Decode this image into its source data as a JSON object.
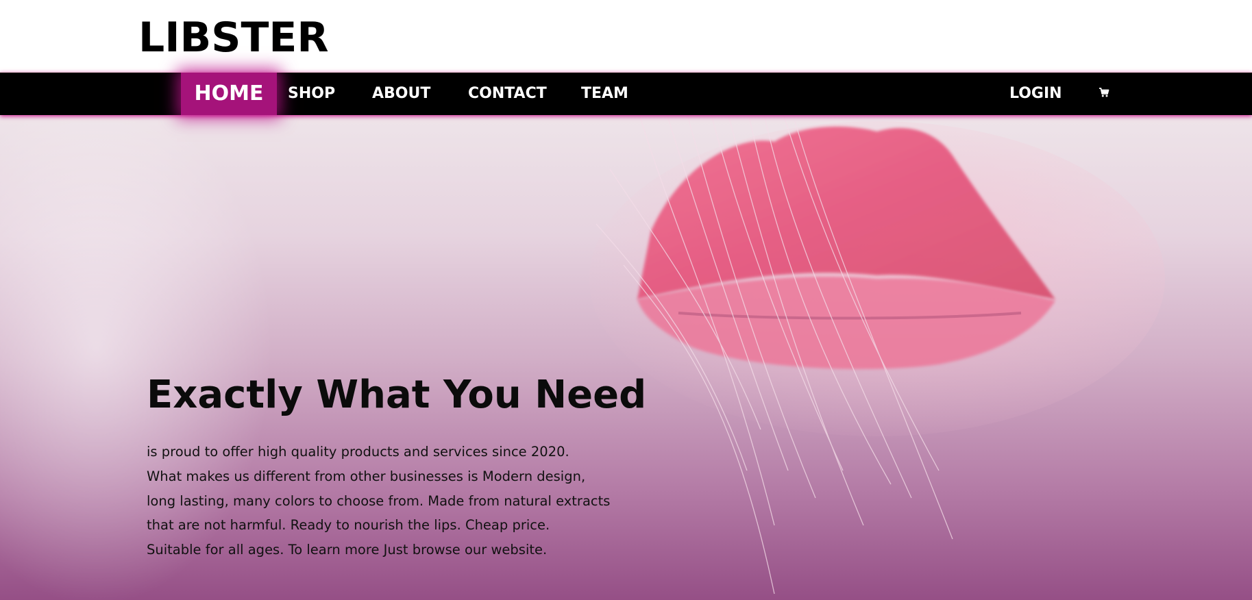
{
  "brand": {
    "name": "LIBSTER"
  },
  "nav": {
    "home": "HOME",
    "shop": "SHOP",
    "about": "ABOUT",
    "contact": "CONTACT",
    "team": "TEAM",
    "login": "LOGIN",
    "cart_icon": "shopping-cart-icon"
  },
  "hero": {
    "title": "Exactly What You Need",
    "lines": [
      "is proud to offer high quality products and services since 2020.",
      "What makes us different from other businesses is Modern design,",
      "long lasting, many colors to choose from. Made from natural extracts",
      "that are not harmful. Ready to nourish the lips. Cheap price.",
      "Suitable for all ages. To learn more Just browse our website."
    ]
  },
  "colors": {
    "accent": "#a5137a",
    "nav_background": "#000000",
    "hero_top": "#eee4e9",
    "hero_bottom": "#954f86"
  }
}
